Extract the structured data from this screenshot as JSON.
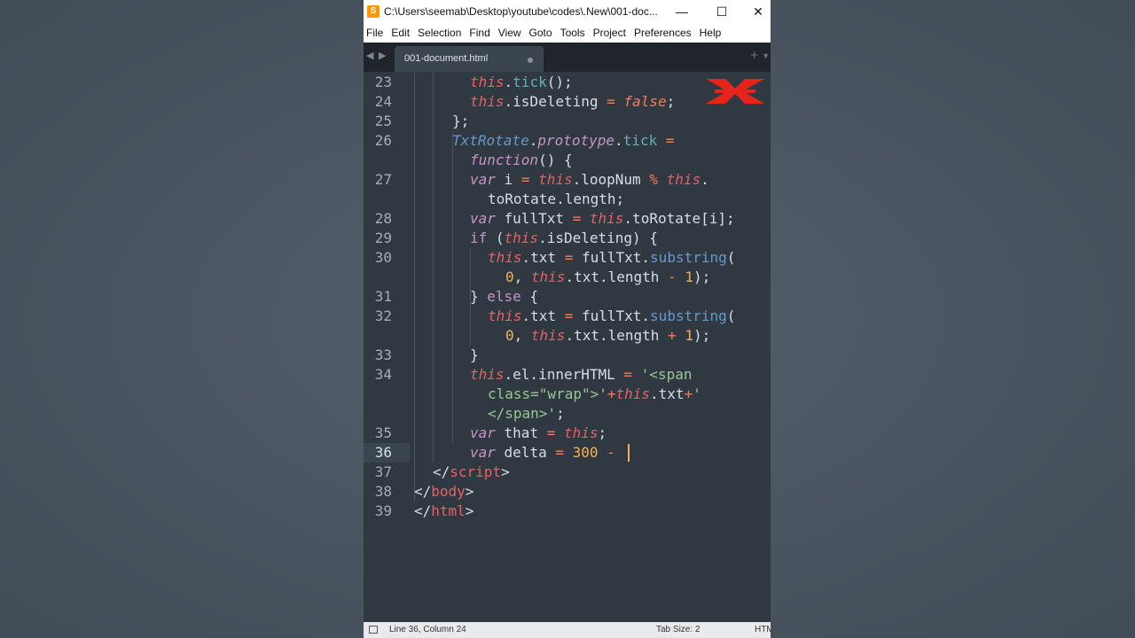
{
  "window": {
    "title": "C:\\Users\\seemab\\Desktop\\youtube\\codes\\.New\\001-doc...",
    "app_icon_letter": "S",
    "minimize": "—",
    "maximize": "☐",
    "close": "✕"
  },
  "menu": [
    "File",
    "Edit",
    "Selection",
    "Find",
    "View",
    "Goto",
    "Tools",
    "Project",
    "Preferences",
    "Help"
  ],
  "tabs": {
    "active_label": "001-document.html",
    "prev_arrow": "◀",
    "next_arrow": "▶",
    "new_tab": "+",
    "dropdown": "▼"
  },
  "colors": {
    "background": "#303841",
    "keyword_this": "#ec5f66",
    "keyword_var": "#c695c6",
    "class_name": "#6699cc",
    "method": "#5fb3b3",
    "string": "#99c794",
    "number": "#f9ae58",
    "operator": "#f97b58",
    "plain": "#d8dee9",
    "caret": "#f9ae58"
  },
  "editor": {
    "line_numbers": [
      "23",
      "24",
      "25",
      "26",
      "",
      "27",
      "",
      "28",
      "29",
      "30",
      "",
      "31",
      "32",
      "",
      "33",
      "34",
      "",
      "",
      "35",
      "36",
      "37",
      "38",
      "39"
    ],
    "current_line": "36",
    "code_lines": [
      [
        {
          "t": "this",
          "c": "keyword_this",
          "i": true
        },
        {
          "t": ".",
          "c": "plain"
        },
        {
          "t": "tick",
          "c": "method"
        },
        {
          "t": "();",
          "c": "plain"
        }
      ],
      [
        {
          "t": "this",
          "c": "keyword_this",
          "i": true
        },
        {
          "t": ".isDeleting ",
          "c": "plain"
        },
        {
          "t": "=",
          "c": "operator"
        },
        {
          "t": " ",
          "c": "plain"
        },
        {
          "t": "false",
          "c": "operator",
          "i": true
        },
        {
          "t": ";",
          "c": "plain"
        }
      ],
      [
        {
          "t": "};",
          "c": "plain"
        }
      ],
      [
        {
          "t": "TxtRotate",
          "c": "class_name",
          "i": true
        },
        {
          "t": ".",
          "c": "plain"
        },
        {
          "t": "prototype",
          "c": "keyword_var",
          "i": true
        },
        {
          "t": ".",
          "c": "plain"
        },
        {
          "t": "tick",
          "c": "method"
        },
        {
          "t": " ",
          "c": "plain"
        },
        {
          "t": "=",
          "c": "operator"
        }
      ],
      [
        {
          "t": "function",
          "c": "keyword_var",
          "i": true
        },
        {
          "t": "() {",
          "c": "plain"
        }
      ],
      [
        {
          "t": "var",
          "c": "keyword_var",
          "i": true
        },
        {
          "t": " i ",
          "c": "plain"
        },
        {
          "t": "=",
          "c": "operator"
        },
        {
          "t": " ",
          "c": "plain"
        },
        {
          "t": "this",
          "c": "keyword_this",
          "i": true
        },
        {
          "t": ".loopNum ",
          "c": "plain"
        },
        {
          "t": "%",
          "c": "operator"
        },
        {
          "t": " ",
          "c": "plain"
        },
        {
          "t": "this",
          "c": "keyword_this",
          "i": true
        },
        {
          "t": ".",
          "c": "plain"
        }
      ],
      [
        {
          "t": "toRotate.length;",
          "c": "plain"
        }
      ],
      [
        {
          "t": "var",
          "c": "keyword_var",
          "i": true
        },
        {
          "t": " fullTxt ",
          "c": "plain"
        },
        {
          "t": "=",
          "c": "operator"
        },
        {
          "t": " ",
          "c": "plain"
        },
        {
          "t": "this",
          "c": "keyword_this",
          "i": true
        },
        {
          "t": ".toRotate[i];",
          "c": "plain"
        }
      ],
      [
        {
          "t": "if",
          "c": "keyword_var"
        },
        {
          "t": " (",
          "c": "plain"
        },
        {
          "t": "this",
          "c": "keyword_this",
          "i": true
        },
        {
          "t": ".isDeleting) {",
          "c": "plain"
        }
      ],
      [
        {
          "t": "this",
          "c": "keyword_this",
          "i": true
        },
        {
          "t": ".txt ",
          "c": "plain"
        },
        {
          "t": "=",
          "c": "operator"
        },
        {
          "t": " fullTxt.",
          "c": "plain"
        },
        {
          "t": "substring",
          "c": "class_name"
        },
        {
          "t": "(",
          "c": "plain"
        }
      ],
      [
        {
          "t": "0",
          "c": "number"
        },
        {
          "t": ", ",
          "c": "plain"
        },
        {
          "t": "this",
          "c": "keyword_this",
          "i": true
        },
        {
          "t": ".txt.length ",
          "c": "plain"
        },
        {
          "t": "-",
          "c": "operator"
        },
        {
          "t": " ",
          "c": "plain"
        },
        {
          "t": "1",
          "c": "number"
        },
        {
          "t": ");",
          "c": "plain"
        }
      ],
      [
        {
          "t": "} ",
          "c": "plain"
        },
        {
          "t": "else",
          "c": "keyword_var"
        },
        {
          "t": " {",
          "c": "plain"
        }
      ],
      [
        {
          "t": "this",
          "c": "keyword_this",
          "i": true
        },
        {
          "t": ".txt ",
          "c": "plain"
        },
        {
          "t": "=",
          "c": "operator"
        },
        {
          "t": " fullTxt.",
          "c": "plain"
        },
        {
          "t": "substring",
          "c": "class_name"
        },
        {
          "t": "(",
          "c": "plain"
        }
      ],
      [
        {
          "t": "0",
          "c": "number"
        },
        {
          "t": ", ",
          "c": "plain"
        },
        {
          "t": "this",
          "c": "keyword_this",
          "i": true
        },
        {
          "t": ".txt.length ",
          "c": "plain"
        },
        {
          "t": "+",
          "c": "operator"
        },
        {
          "t": " ",
          "c": "plain"
        },
        {
          "t": "1",
          "c": "number"
        },
        {
          "t": ");",
          "c": "plain"
        }
      ],
      [
        {
          "t": "}",
          "c": "plain"
        }
      ],
      [
        {
          "t": "this",
          "c": "keyword_this",
          "i": true
        },
        {
          "t": ".el.innerHTML ",
          "c": "plain"
        },
        {
          "t": "=",
          "c": "operator"
        },
        {
          "t": " ",
          "c": "plain"
        },
        {
          "t": "'<span",
          "c": "string"
        }
      ],
      [
        {
          "t": "class=\"wrap\">'",
          "c": "string"
        },
        {
          "t": "+",
          "c": "operator"
        },
        {
          "t": "this",
          "c": "keyword_this",
          "i": true
        },
        {
          "t": ".txt",
          "c": "plain"
        },
        {
          "t": "+",
          "c": "operator"
        },
        {
          "t": "'",
          "c": "string"
        }
      ],
      [
        {
          "t": "</span>'",
          "c": "string"
        },
        {
          "t": ";",
          "c": "plain"
        }
      ],
      [
        {
          "t": "var",
          "c": "keyword_var",
          "i": true
        },
        {
          "t": " that ",
          "c": "plain"
        },
        {
          "t": "=",
          "c": "operator"
        },
        {
          "t": " ",
          "c": "plain"
        },
        {
          "t": "this",
          "c": "keyword_this",
          "i": true
        },
        {
          "t": ";",
          "c": "plain"
        }
      ],
      [
        {
          "t": "var",
          "c": "keyword_var",
          "i": true
        },
        {
          "t": " delta ",
          "c": "plain"
        },
        {
          "t": "=",
          "c": "operator"
        },
        {
          "t": " ",
          "c": "plain"
        },
        {
          "t": "300",
          "c": "number"
        },
        {
          "t": " ",
          "c": "plain"
        },
        {
          "t": "-",
          "c": "operator"
        }
      ],
      [
        {
          "t": "</",
          "c": "plain"
        },
        {
          "t": "script",
          "c": "keyword_this"
        },
        {
          "t": ">",
          "c": "plain"
        }
      ],
      [
        {
          "t": "</",
          "c": "plain"
        },
        {
          "t": "body",
          "c": "keyword_this"
        },
        {
          "t": ">",
          "c": "plain"
        }
      ],
      [
        {
          "t": "</",
          "c": "plain"
        },
        {
          "t": "html",
          "c": "keyword_this"
        },
        {
          "t": ">",
          "c": "plain"
        }
      ]
    ]
  },
  "status": {
    "position": "Line 36, Column 24",
    "tab_size": "Tab Size: 2",
    "syntax": "HTML"
  }
}
